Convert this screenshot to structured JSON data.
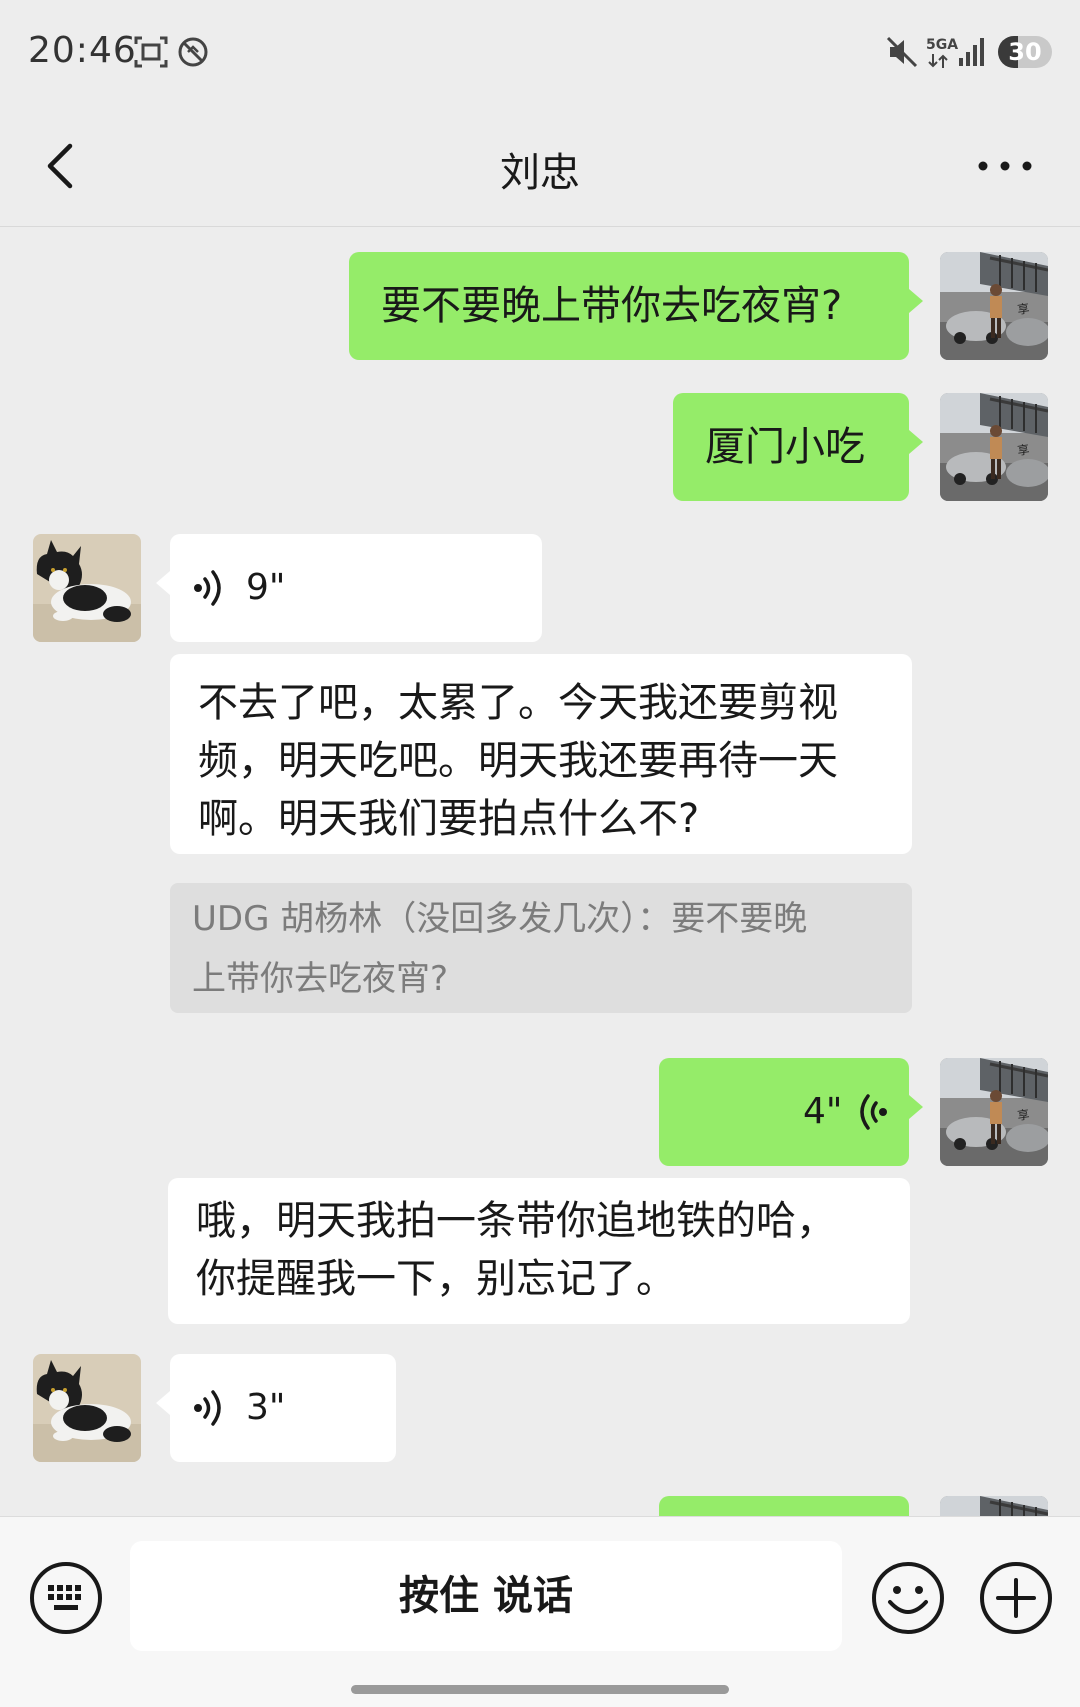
{
  "status_bar": {
    "time": "20:46",
    "network": "5GA",
    "battery": "30"
  },
  "nav": {
    "title": "刘忠"
  },
  "messages": [
    {
      "sender": "me",
      "type": "text",
      "text": "要不要晚上带你去吃夜宵?"
    },
    {
      "sender": "me",
      "type": "text",
      "text": "厦门小吃"
    },
    {
      "sender": "other",
      "type": "voice",
      "duration": "9\""
    },
    {
      "sender": "other",
      "type": "transcription",
      "lines": [
        "不去了吧，太累了。今天我还要剪视",
        "频，明天吃吧。明天我还要再待一天",
        "啊。明天我们要拍点什么不?"
      ]
    },
    {
      "sender": "other",
      "type": "quote",
      "lines": [
        "UDG 胡杨林（没回多发几次）：要不要晚",
        "上带你去吃夜宵?"
      ]
    },
    {
      "sender": "me",
      "type": "voice",
      "duration": "4\""
    },
    {
      "sender": "other",
      "type": "transcription",
      "lines": [
        "哦，明天我拍一条带你追地铁的哈，",
        "你提醒我一下，别忘记了。"
      ]
    },
    {
      "sender": "other",
      "type": "voice",
      "duration": "3\""
    }
  ],
  "input_bar": {
    "hold_to_talk": "按住 说话"
  },
  "colors": {
    "background": "#ededed",
    "my_bubble": "#95ec69",
    "other_bubble": "#ffffff",
    "quote_bg": "#dedede"
  },
  "icons": [
    "screenshot-icon",
    "block-icon",
    "mute-icon",
    "signal-icon",
    "back-icon",
    "more-icon",
    "voice-icon",
    "keyboard-icon",
    "emoji-icon",
    "plus-icon"
  ]
}
